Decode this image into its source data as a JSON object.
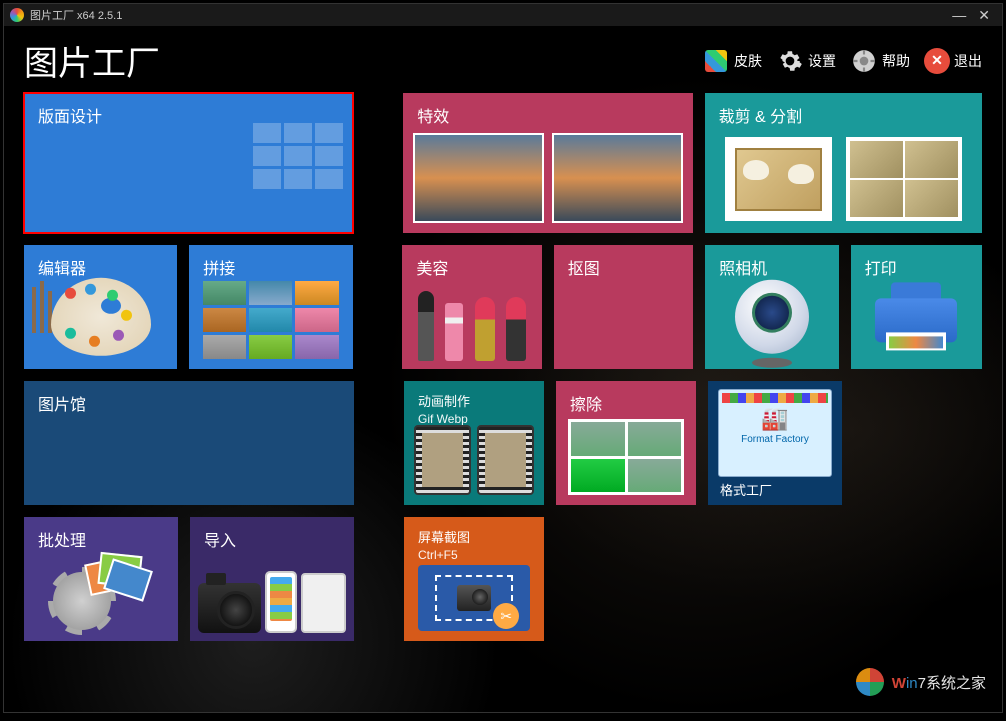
{
  "titlebar": {
    "text": "图片工厂 x64 2.5.1"
  },
  "header": {
    "app_title": "图片工厂",
    "skin": "皮肤",
    "settings": "设置",
    "help": "帮助",
    "exit": "退出"
  },
  "tiles": {
    "layout": "版面设计",
    "effects": "特效",
    "crop_split": "裁剪 & 分割",
    "editor": "编辑器",
    "collage": "拼接",
    "beauty": "美容",
    "cutout": "抠图",
    "camera": "照相机",
    "print": "打印",
    "gallery": "图片馆",
    "anim_make": "动画制作",
    "anim_sub": "Gif Webp",
    "erase": "擦除",
    "format_factory_label": "格式工厂",
    "format_factory_inner": "Format Factory",
    "batch": "批处理",
    "import": "导入",
    "screenshot": "屏幕截图",
    "screenshot_sub": "Ctrl+F5"
  },
  "watermark": {
    "text_a": "W",
    "text_b": "in",
    "text_c": "7系统之家"
  }
}
